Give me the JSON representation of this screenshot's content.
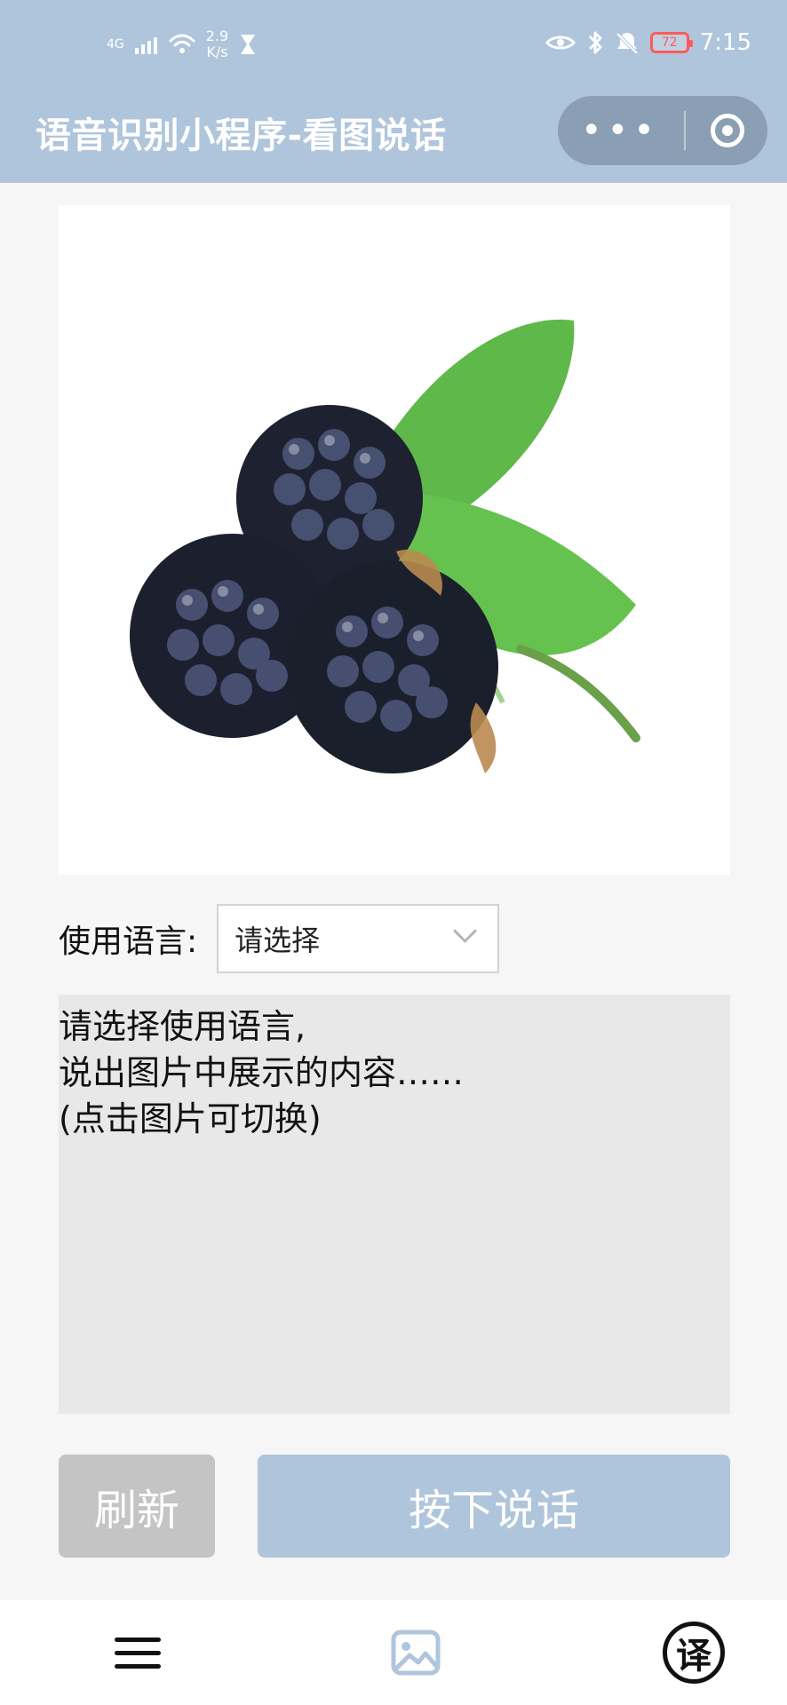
{
  "status_bar": {
    "network": "4G",
    "speed_value": "2.9",
    "speed_unit": "K/s",
    "battery": "72",
    "time": "7:15"
  },
  "nav": {
    "title": "语音识别小程序-看图说话",
    "more_icon": "more-icon",
    "close_icon": "target-icon"
  },
  "content": {
    "image_icon": "blackberry-photo",
    "language_label": "使用语言:",
    "language_select_value": "请选择",
    "prompt_text": "请选择使用语言,\n说出图片中展示的内容……\n(点击图片可切换)"
  },
  "buttons": {
    "refresh": "刷新",
    "speak": "按下说话"
  },
  "tabbar": {
    "menu_icon": "menu-icon",
    "image_icon": "image-icon",
    "translate_label": "译"
  },
  "colors": {
    "nav_bg": "#afc5db",
    "button_speak_bg": "#afc5db",
    "button_refresh_bg": "#c4c4c4",
    "textarea_bg": "#e8e8e8",
    "page_bg": "#f6f6f6"
  }
}
